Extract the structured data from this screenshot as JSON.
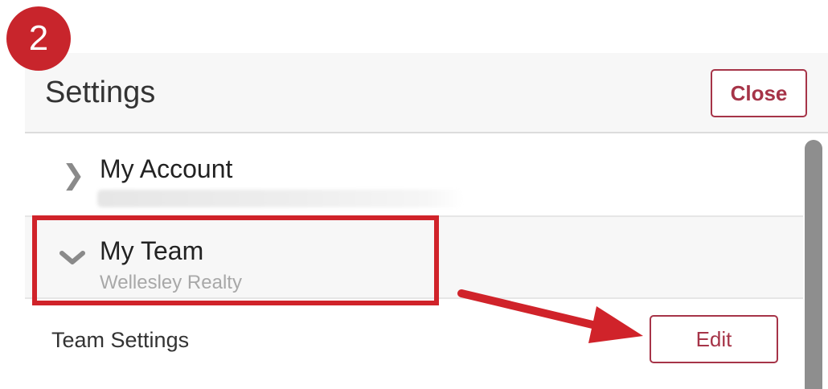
{
  "step_badge": "2",
  "header": {
    "title": "Settings",
    "close_label": "Close"
  },
  "sections": {
    "account": {
      "title": "My Account",
      "chevron_icon": "chevron-right-icon"
    },
    "team": {
      "title": "My Team",
      "subtitle": "Wellesley Realty",
      "chevron_icon": "chevron-down-icon"
    }
  },
  "team_settings": {
    "label": "Team Settings",
    "edit_label": "Edit"
  },
  "colors": {
    "accent": "#a63448",
    "annotation_red": "#d0232a",
    "header_bg": "#f7f7f7"
  }
}
